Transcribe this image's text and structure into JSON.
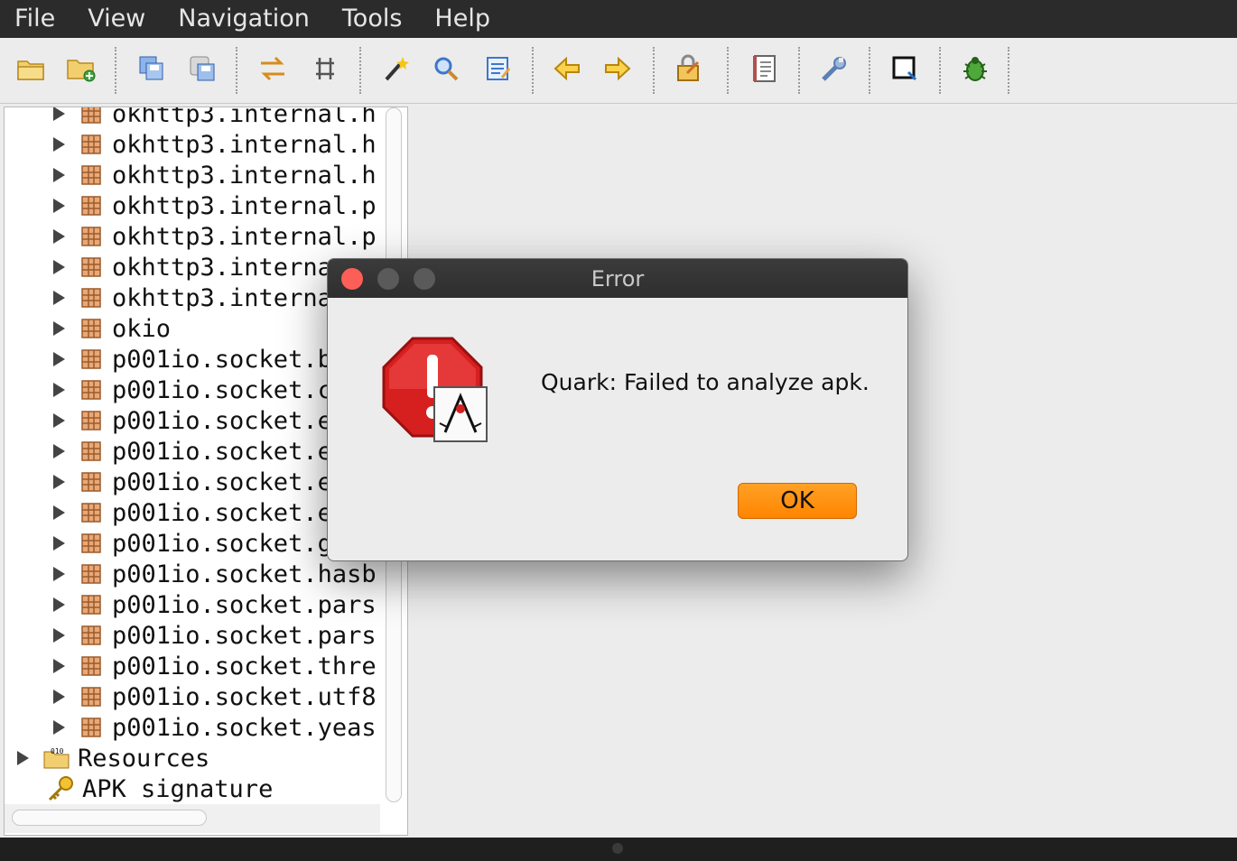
{
  "menu": [
    "File",
    "View",
    "Navigation",
    "Tools",
    "Help"
  ],
  "toolbar": {
    "buttons": [
      {
        "name": "open-file-icon",
        "color": "#e8b84a"
      },
      {
        "name": "add-file-icon",
        "color": "#e8b84a"
      },
      {
        "name": "save-all-icon",
        "color": "#5a8ad6"
      },
      {
        "name": "export-icon",
        "color": "#5a8ad6"
      },
      {
        "name": "sync-icon",
        "color": "#e8a43a"
      },
      {
        "name": "flatten-packages-icon",
        "color": "#555555"
      },
      {
        "name": "magic-wand-icon",
        "color": "#333333"
      },
      {
        "name": "search-icon",
        "color": "#4f86d9"
      },
      {
        "name": "find-class-icon",
        "color": "#4f86d9"
      },
      {
        "name": "back-arrow-icon",
        "color": "#f0b429"
      },
      {
        "name": "forward-arrow-icon",
        "color": "#f0b429"
      },
      {
        "name": "deobfuscation-icon",
        "color": "#e8a43a"
      },
      {
        "name": "log-viewer-icon",
        "color": "#b05050"
      },
      {
        "name": "preferences-wrench-icon",
        "color": "#5a7fb5"
      },
      {
        "name": "quark-icon",
        "color": "#111111"
      },
      {
        "name": "debug-bug-icon",
        "color": "#3a8a2a"
      }
    ]
  },
  "tree": {
    "packages": [
      "okhttp3.internal.h",
      "okhttp3.internal.h",
      "okhttp3.internal.h",
      "okhttp3.internal.p",
      "okhttp3.internal.p",
      "okhttp3.interna",
      "okhttp3.interna",
      "okio",
      "p001io.socket.b",
      "p001io.socket.c",
      "p001io.socket.e",
      "p001io.socket.e",
      "p001io.socket.e",
      "p001io.socket.e",
      "p001io.socket.g",
      "p001io.socket.hasb",
      "p001io.socket.pars",
      "p001io.socket.pars",
      "p001io.socket.thre",
      "p001io.socket.utf8",
      "p001io.socket.yeas"
    ],
    "resources_label": "Resources",
    "signature_label": "APK signature"
  },
  "dialog": {
    "title": "Error",
    "message": "Quark: Failed to analyze apk.",
    "ok_label": "OK",
    "accent": "#ff8c00"
  }
}
